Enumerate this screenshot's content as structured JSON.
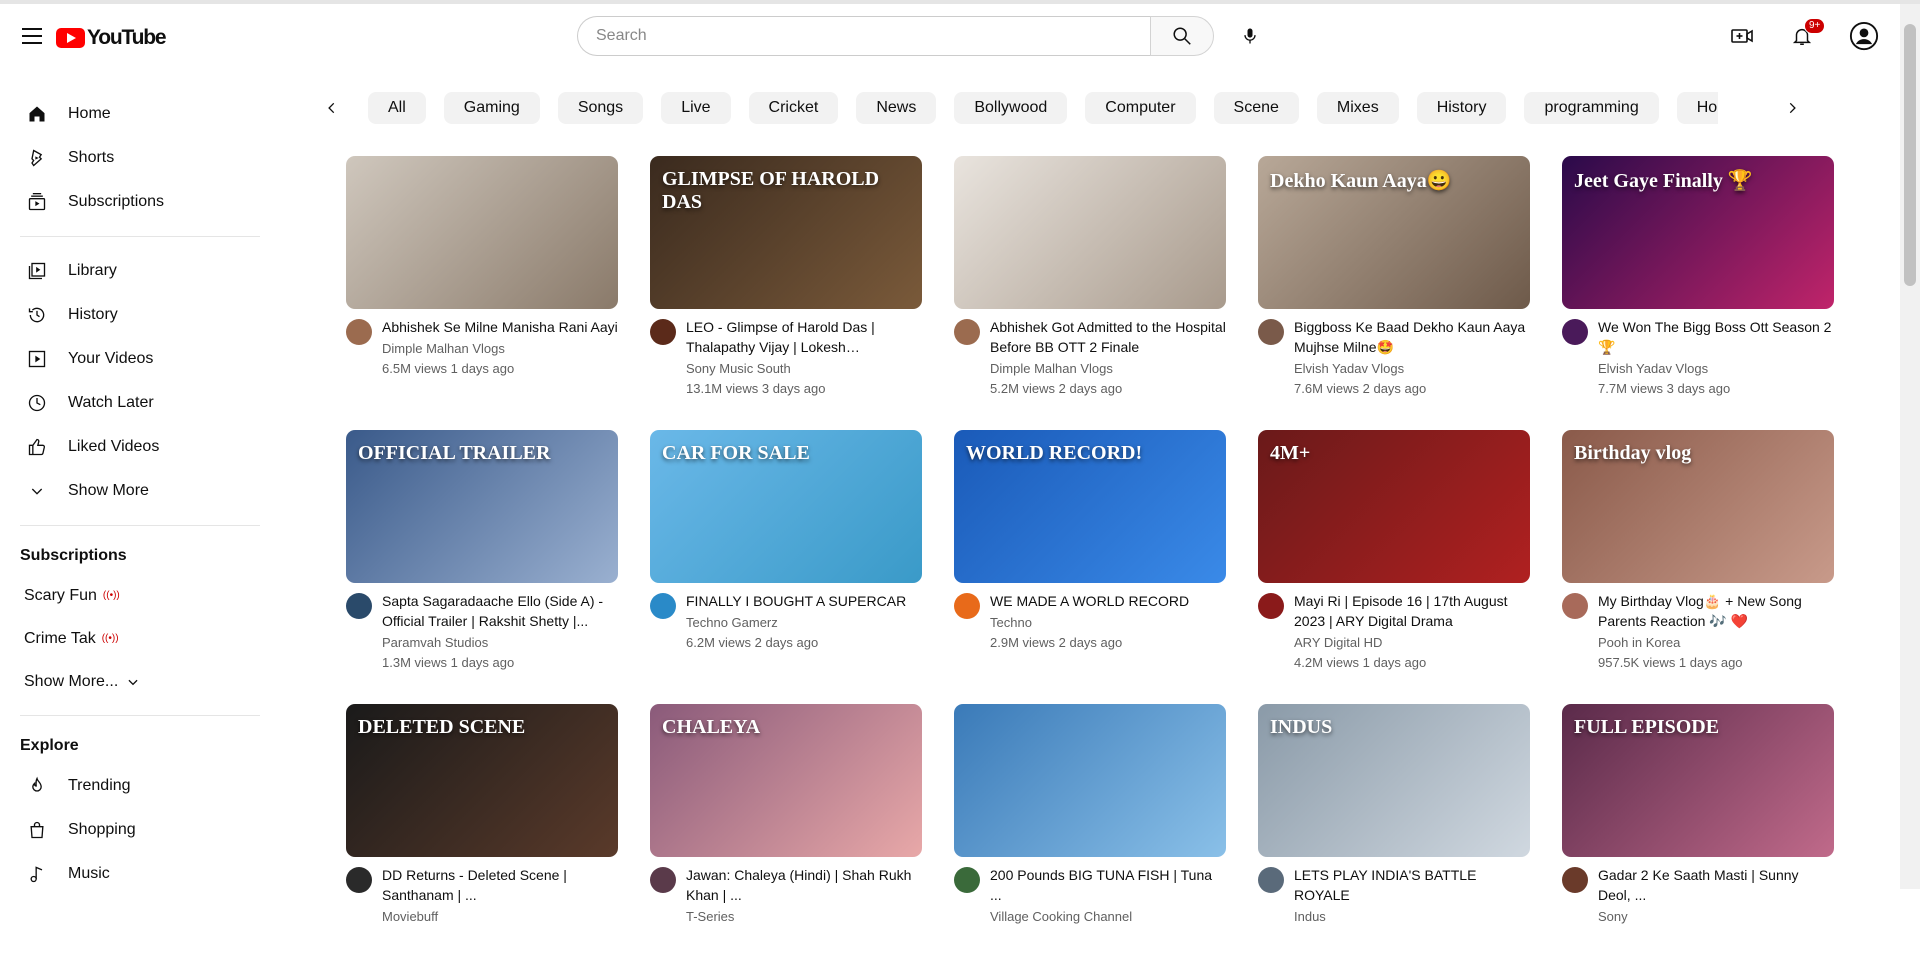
{
  "header": {
    "logo_text": "YouTube",
    "search_placeholder": "Search",
    "notification_count": "9+"
  },
  "sidebar": {
    "main": [
      {
        "label": "Home",
        "icon": "home-icon"
      },
      {
        "label": "Shorts",
        "icon": "shorts-icon"
      },
      {
        "label": "Subscriptions",
        "icon": "subscriptions-icon"
      }
    ],
    "you": [
      {
        "label": "Library",
        "icon": "library-icon"
      },
      {
        "label": "History",
        "icon": "history-icon"
      },
      {
        "label": "Your Videos",
        "icon": "your-videos-icon"
      },
      {
        "label": "Watch Later",
        "icon": "watch-later-icon"
      },
      {
        "label": "Liked Videos",
        "icon": "liked-videos-icon"
      },
      {
        "label": "Show More",
        "icon": "chevron-down-icon"
      }
    ],
    "subscriptions_title": "Subscriptions",
    "subscriptions": [
      {
        "label": "Scary Fun",
        "live": "((•))"
      },
      {
        "label": "Crime Tak",
        "live": "((•))"
      }
    ],
    "subscriptions_more": "Show More...",
    "explore_title": "Explore",
    "explore": [
      {
        "label": "Trending",
        "icon": "trending-icon"
      },
      {
        "label": "Shopping",
        "icon": "shopping-icon"
      },
      {
        "label": "Music",
        "icon": "music-icon"
      }
    ]
  },
  "chips": [
    "All",
    "Gaming",
    "Songs",
    "Live",
    "Cricket",
    "News",
    "Bollywood",
    "Computer",
    "Scene",
    "Mixes",
    "History",
    "programming",
    "Hollywood"
  ],
  "videos": [
    {
      "title": "Abhishek Se Milne Manisha Rani Aayi",
      "channel": "Dimple Malhan Vlogs",
      "stats": "6.5M views 1 days ago",
      "thumb": [
        "#cfc7bd",
        "#8a7a6a"
      ],
      "avatar": "#9b6b4f",
      "overlay": ""
    },
    {
      "title": "LEO - Glimpse of Harold Das | Thalapathy Vijay | Lokesh Kanagaraj...",
      "channel": "Sony Music South",
      "stats": "13.1M views 3 days ago",
      "thumb": [
        "#3a2a1e",
        "#7a5a3a"
      ],
      "avatar": "#5b2a1a",
      "overlay": "GLIMPSE OF HAROLD DAS"
    },
    {
      "title": "Abhishek Got Admitted to the Hospital Before BB OTT 2 Finale",
      "channel": "Dimple Malhan Vlogs",
      "stats": "5.2M views 2 days ago",
      "thumb": [
        "#e9e4de",
        "#a89a8c"
      ],
      "avatar": "#9b6b4f",
      "overlay": ""
    },
    {
      "title": "Biggboss Ke Baad Dekho Kaun Aaya Mujhse Milne🤩",
      "channel": "Elvish Yadav Vlogs",
      "stats": "7.6M views 2 days ago",
      "thumb": [
        "#b8a898",
        "#6e5a4a"
      ],
      "avatar": "#7a5a4a",
      "overlay": "Dekho Kaun Aaya😀"
    },
    {
      "title": "We Won The Bigg Boss Ott Season 2 🏆",
      "channel": "Elvish Yadav Vlogs",
      "stats": "7.7M views 3 days ago",
      "thumb": [
        "#2a0a4a",
        "#c0246a"
      ],
      "avatar": "#4a1a5a",
      "overlay": "Jeet Gaye Finally 🏆"
    },
    {
      "title": "Sapta Sagaradaache Ello (Side A) - Official Trailer | Rakshit Shetty |...",
      "channel": "Paramvah Studios",
      "stats": "1.3M views 1 days ago",
      "thumb": [
        "#3a5a8a",
        "#9ab0d0"
      ],
      "avatar": "#2a4a6a",
      "overlay": "OFFICIAL TRAILER"
    },
    {
      "title": "FINALLY I BOUGHT A SUPERCAR",
      "channel": "Techno Gamerz",
      "stats": "6.2M views 2 days ago",
      "thumb": [
        "#6ab8e8",
        "#3a9ac8"
      ],
      "avatar": "#2a8ac8",
      "overlay": "CAR FOR SALE"
    },
    {
      "title": "WE MADE A WORLD RECORD",
      "channel": "Techno",
      "stats": "2.9M views 2 days ago",
      "thumb": [
        "#1a5ab8",
        "#3a8ae8"
      ],
      "avatar": "#e86a1a",
      "overlay": "WORLD RECORD!"
    },
    {
      "title": "Mayi Ri | Episode 16 | 17th August 2023 | ARY Digital Drama",
      "channel": "ARY Digital HD",
      "stats": "4.2M views 1 days ago",
      "thumb": [
        "#6a1a1a",
        "#b02020"
      ],
      "avatar": "#8a1a1a",
      "overlay": "4M+"
    },
    {
      "title": "My Birthday Vlog🎂 + New Song Parents Reaction 🎶 ❤️",
      "channel": "Pooh in Korea",
      "stats": "957.5K views 1 days ago",
      "thumb": [
        "#8a5a4a",
        "#c89a8a"
      ],
      "avatar": "#a86a5a",
      "overlay": "Birthday vlog"
    },
    {
      "title": "DD Returns - Deleted Scene | Santhanam | ...",
      "channel": "Moviebuff",
      "stats": "",
      "thumb": [
        "#1a1a1a",
        "#5a3a2a"
      ],
      "avatar": "#2a2a2a",
      "overlay": "DELETED SCENE"
    },
    {
      "title": "Jawan: Chaleya (Hindi) | Shah Rukh Khan | ...",
      "channel": "T-Series",
      "stats": "",
      "thumb": [
        "#8a5a7a",
        "#e8a8a8"
      ],
      "avatar": "#5a3a4a",
      "overlay": "CHALEYA"
    },
    {
      "title": "200 Pounds BIG TUNA FISH | Tuna ...",
      "channel": "Village Cooking Channel",
      "stats": "",
      "thumb": [
        "#3a7ab8",
        "#8ac0e8"
      ],
      "avatar": "#3a6a3a",
      "overlay": ""
    },
    {
      "title": "LETS PLAY INDIA'S BATTLE ROYALE",
      "channel": "Indus",
      "stats": "",
      "thumb": [
        "#8a9aa8",
        "#d0d8e0"
      ],
      "avatar": "#5a6a7a",
      "overlay": "INDUS"
    },
    {
      "title": "Gadar 2 Ke Saath Masti | Sunny Deol, ...",
      "channel": "Sony",
      "stats": "",
      "thumb": [
        "#5a2a4a",
        "#c06a8a"
      ],
      "avatar": "#6a3a2a",
      "overlay": "FULL EPISODE"
    }
  ]
}
